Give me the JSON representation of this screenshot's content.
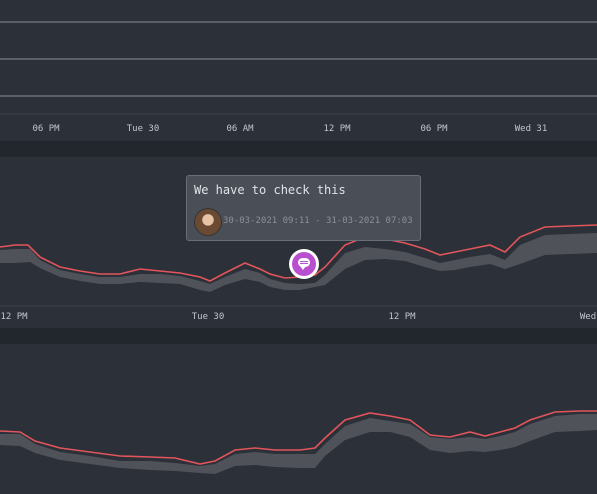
{
  "panel1": {
    "axis_labels": [
      "06 PM",
      "Tue 30",
      "06 AM",
      "12 PM",
      "06 PM",
      "Wed 31"
    ]
  },
  "panel2": {
    "axis_labels": [
      "12 PM",
      "Tue 30",
      "12 PM",
      "Wed"
    ]
  },
  "annotation": {
    "text": "We have to check this",
    "time_range": "30-03-2021 09:11 - 31-03-2021 07:03",
    "icon": "comment-icon"
  },
  "colors": {
    "background": "#2b3039",
    "series_line": "#e2555a",
    "band": "#4f5258",
    "marker": "#b84fcf",
    "tooltip_bg": "#4a4f57"
  }
}
